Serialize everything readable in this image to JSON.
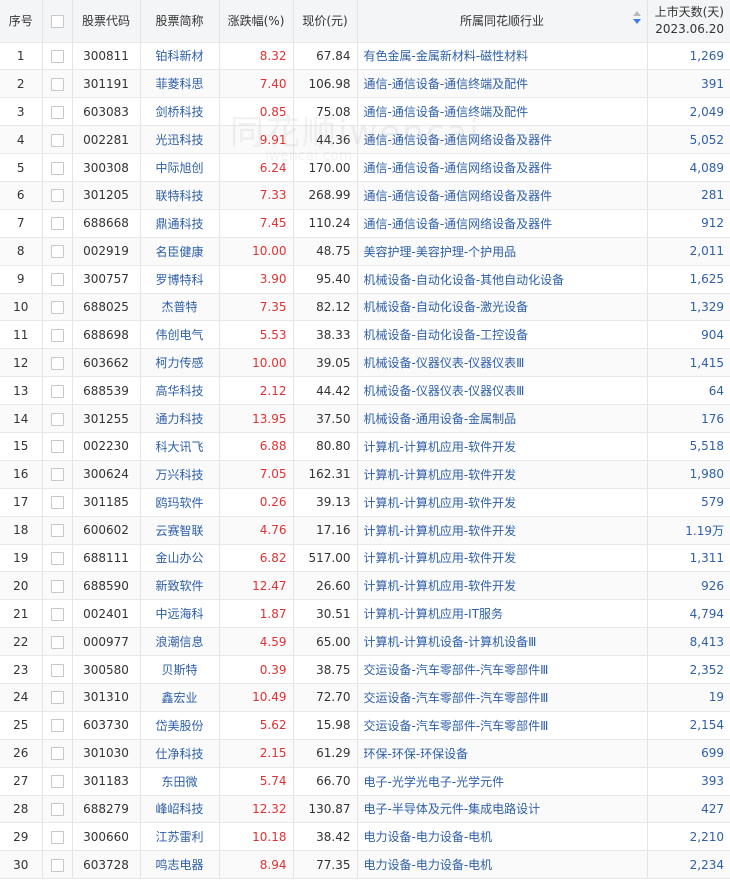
{
  "headers": {
    "idx": "序号",
    "code": "股票代码",
    "name": "股票简称",
    "pct": "涨跌幅(%)",
    "price": "现价(元)",
    "industry": "所属同花顺行业",
    "days_title": "上市天数(天)",
    "days_date": "2023.06.20"
  },
  "watermark": {
    "text": "同花顺iwencai",
    "sub": "iwencai.com"
  },
  "accent": {
    "rise": "#e03131",
    "link": "#2e5fa8",
    "sort_active": "#3f7ee8"
  },
  "rows": [
    {
      "idx": "1",
      "code": "300811",
      "name": "铂科新材",
      "pct": "8.32",
      "price": "67.84",
      "industry": "有色金属-金属新材料-磁性材料",
      "days": "1,269"
    },
    {
      "idx": "2",
      "code": "301191",
      "name": "菲菱科思",
      "pct": "7.40",
      "price": "106.98",
      "industry": "通信-通信设备-通信终端及配件",
      "days": "391"
    },
    {
      "idx": "3",
      "code": "603083",
      "name": "剑桥科技",
      "pct": "0.85",
      "price": "75.08",
      "industry": "通信-通信设备-通信终端及配件",
      "days": "2,049"
    },
    {
      "idx": "4",
      "code": "002281",
      "name": "光迅科技",
      "pct": "9.91",
      "price": "44.36",
      "industry": "通信-通信设备-通信网络设备及器件",
      "days": "5,052"
    },
    {
      "idx": "5",
      "code": "300308",
      "name": "中际旭创",
      "pct": "6.24",
      "price": "170.00",
      "industry": "通信-通信设备-通信网络设备及器件",
      "days": "4,089"
    },
    {
      "idx": "6",
      "code": "301205",
      "name": "联特科技",
      "pct": "7.33",
      "price": "268.99",
      "industry": "通信-通信设备-通信网络设备及器件",
      "days": "281"
    },
    {
      "idx": "7",
      "code": "688668",
      "name": "鼎通科技",
      "pct": "7.45",
      "price": "110.24",
      "industry": "通信-通信设备-通信网络设备及器件",
      "days": "912"
    },
    {
      "idx": "8",
      "code": "002919",
      "name": "名臣健康",
      "pct": "10.00",
      "price": "48.75",
      "industry": "美容护理-美容护理-个护用品",
      "days": "2,011"
    },
    {
      "idx": "9",
      "code": "300757",
      "name": "罗博特科",
      "pct": "3.90",
      "price": "95.40",
      "industry": "机械设备-自动化设备-其他自动化设备",
      "days": "1,625"
    },
    {
      "idx": "10",
      "code": "688025",
      "name": "杰普特",
      "pct": "7.35",
      "price": "82.12",
      "industry": "机械设备-自动化设备-激光设备",
      "days": "1,329"
    },
    {
      "idx": "11",
      "code": "688698",
      "name": "伟创电气",
      "pct": "5.53",
      "price": "38.33",
      "industry": "机械设备-自动化设备-工控设备",
      "days": "904"
    },
    {
      "idx": "12",
      "code": "603662",
      "name": "柯力传感",
      "pct": "10.00",
      "price": "39.05",
      "industry": "机械设备-仪器仪表-仪器仪表Ⅲ",
      "days": "1,415"
    },
    {
      "idx": "13",
      "code": "688539",
      "name": "高华科技",
      "pct": "2.12",
      "price": "44.42",
      "industry": "机械设备-仪器仪表-仪器仪表Ⅲ",
      "days": "64"
    },
    {
      "idx": "14",
      "code": "301255",
      "name": "通力科技",
      "pct": "13.95",
      "price": "37.50",
      "industry": "机械设备-通用设备-金属制品",
      "days": "176"
    },
    {
      "idx": "15",
      "code": "002230",
      "name": "科大讯飞",
      "pct": "6.88",
      "price": "80.80",
      "industry": "计算机-计算机应用-软件开发",
      "days": "5,518"
    },
    {
      "idx": "16",
      "code": "300624",
      "name": "万兴科技",
      "pct": "7.05",
      "price": "162.31",
      "industry": "计算机-计算机应用-软件开发",
      "days": "1,980"
    },
    {
      "idx": "17",
      "code": "301185",
      "name": "鸥玛软件",
      "pct": "0.26",
      "price": "39.13",
      "industry": "计算机-计算机应用-软件开发",
      "days": "579"
    },
    {
      "idx": "18",
      "code": "600602",
      "name": "云赛智联",
      "pct": "4.76",
      "price": "17.16",
      "industry": "计算机-计算机应用-软件开发",
      "days": "1.19万"
    },
    {
      "idx": "19",
      "code": "688111",
      "name": "金山办公",
      "pct": "6.82",
      "price": "517.00",
      "industry": "计算机-计算机应用-软件开发",
      "days": "1,311"
    },
    {
      "idx": "20",
      "code": "688590",
      "name": "新致软件",
      "pct": "12.47",
      "price": "26.60",
      "industry": "计算机-计算机应用-软件开发",
      "days": "926"
    },
    {
      "idx": "21",
      "code": "002401",
      "name": "中远海科",
      "pct": "1.87",
      "price": "30.51",
      "industry": "计算机-计算机应用-IT服务",
      "days": "4,794"
    },
    {
      "idx": "22",
      "code": "000977",
      "name": "浪潮信息",
      "pct": "4.59",
      "price": "65.00",
      "industry": "计算机-计算机设备-计算机设备Ⅲ",
      "days": "8,413"
    },
    {
      "idx": "23",
      "code": "300580",
      "name": "贝斯特",
      "pct": "0.39",
      "price": "38.75",
      "industry": "交运设备-汽车零部件-汽车零部件Ⅲ",
      "days": "2,352"
    },
    {
      "idx": "24",
      "code": "301310",
      "name": "鑫宏业",
      "pct": "10.49",
      "price": "72.70",
      "industry": "交运设备-汽车零部件-汽车零部件Ⅲ",
      "days": "19"
    },
    {
      "idx": "25",
      "code": "603730",
      "name": "岱美股份",
      "pct": "5.62",
      "price": "15.98",
      "industry": "交运设备-汽车零部件-汽车零部件Ⅲ",
      "days": "2,154"
    },
    {
      "idx": "26",
      "code": "301030",
      "name": "仕净科技",
      "pct": "2.15",
      "price": "61.29",
      "industry": "环保-环保-环保设备",
      "days": "699"
    },
    {
      "idx": "27",
      "code": "301183",
      "name": "东田微",
      "pct": "5.74",
      "price": "66.70",
      "industry": "电子-光学光电子-光学元件",
      "days": "393"
    },
    {
      "idx": "28",
      "code": "688279",
      "name": "峰岹科技",
      "pct": "12.32",
      "price": "130.87",
      "industry": "电子-半导体及元件-集成电路设计",
      "days": "427"
    },
    {
      "idx": "29",
      "code": "300660",
      "name": "江苏雷利",
      "pct": "10.18",
      "price": "38.42",
      "industry": "电力设备-电力设备-电机",
      "days": "2,210"
    },
    {
      "idx": "30",
      "code": "603728",
      "name": "鸣志电器",
      "pct": "8.94",
      "price": "77.35",
      "industry": "电力设备-电力设备-电机",
      "days": "2,234"
    }
  ]
}
